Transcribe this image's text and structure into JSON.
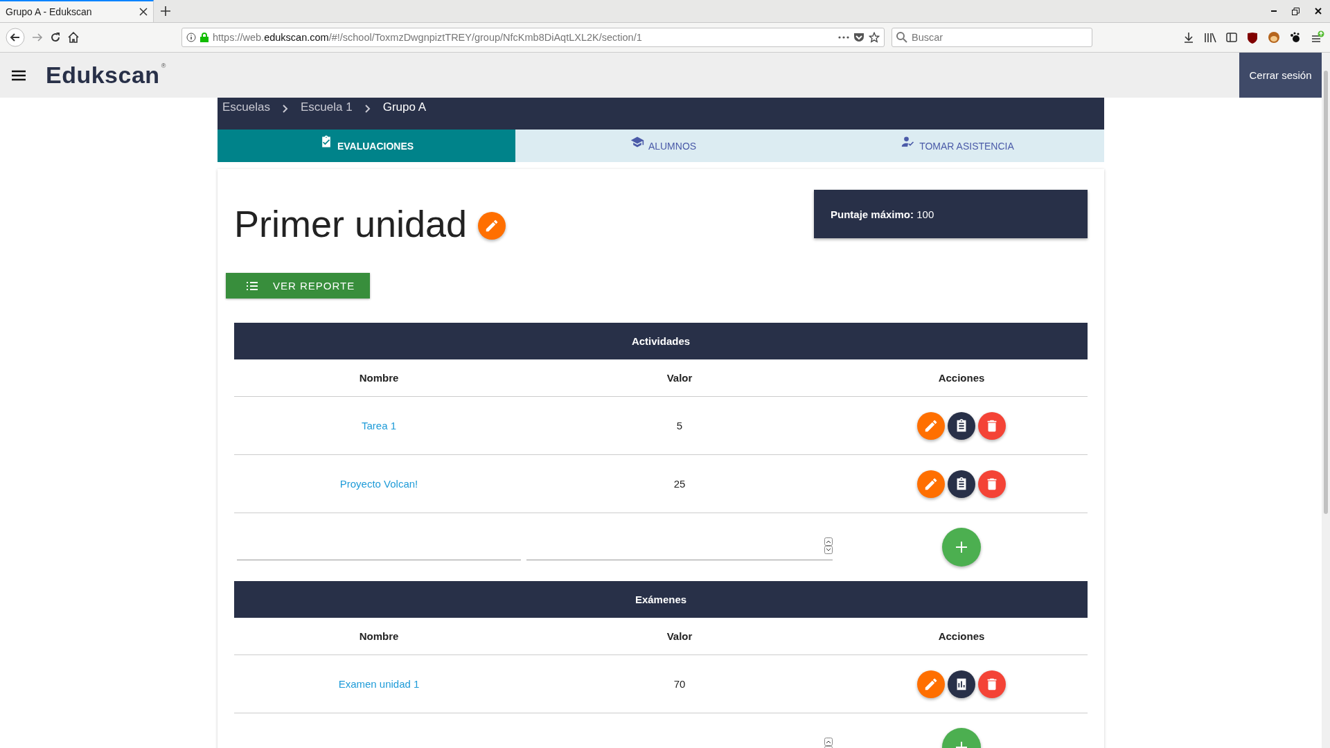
{
  "browser": {
    "tab_title": "Grupo A - Edukscan",
    "url_prefix": "https://web.",
    "url_domain": "edukscan.com",
    "url_path": "/#!/school/ToxmzDwgnpiztTREY/group/NfcKmb8DiAqtLXL2K/section/1",
    "search_placeholder": "Buscar"
  },
  "header": {
    "logo": "Edukscan",
    "logo_mark": "®",
    "logout": "Cerrar sesión"
  },
  "breadcrumbs": [
    {
      "label": "Escuelas",
      "current": false
    },
    {
      "label": "Escuela 1",
      "current": false
    },
    {
      "label": "Grupo A",
      "current": true
    }
  ],
  "tabs": [
    {
      "label": "EVALUACIONES",
      "selected": true,
      "kind": "clipboard"
    },
    {
      "label": "ALUMNOS",
      "selected": false,
      "kind": "cap"
    },
    {
      "label": "TOMAR ASISTENCIA",
      "selected": false,
      "kind": "person"
    }
  ],
  "title": "Primer unidad",
  "max_score": {
    "label": "Puntaje máximo:",
    "value": "100"
  },
  "report_button": "VER REPORTE",
  "sections": [
    {
      "title": "Actividades",
      "columns": [
        "Nombre",
        "Valor",
        "Acciones"
      ],
      "rows": [
        {
          "name": "Tarea 1",
          "value": "5",
          "actions": [
            {
              "kind": "edit"
            },
            {
              "kind": "notes"
            },
            {
              "kind": "delete"
            }
          ]
        },
        {
          "name": "Proyecto Volcan!",
          "value": "25",
          "actions": [
            {
              "kind": "edit"
            },
            {
              "kind": "notes"
            },
            {
              "kind": "delete"
            }
          ]
        }
      ]
    },
    {
      "title": "Exámenes",
      "columns": [
        "Nombre",
        "Valor",
        "Acciones"
      ],
      "rows": [
        {
          "name": "Examen unidad 1",
          "value": "70",
          "actions": [
            {
              "kind": "edit"
            },
            {
              "kind": "chart"
            },
            {
              "kind": "delete"
            }
          ]
        }
      ]
    }
  ]
}
